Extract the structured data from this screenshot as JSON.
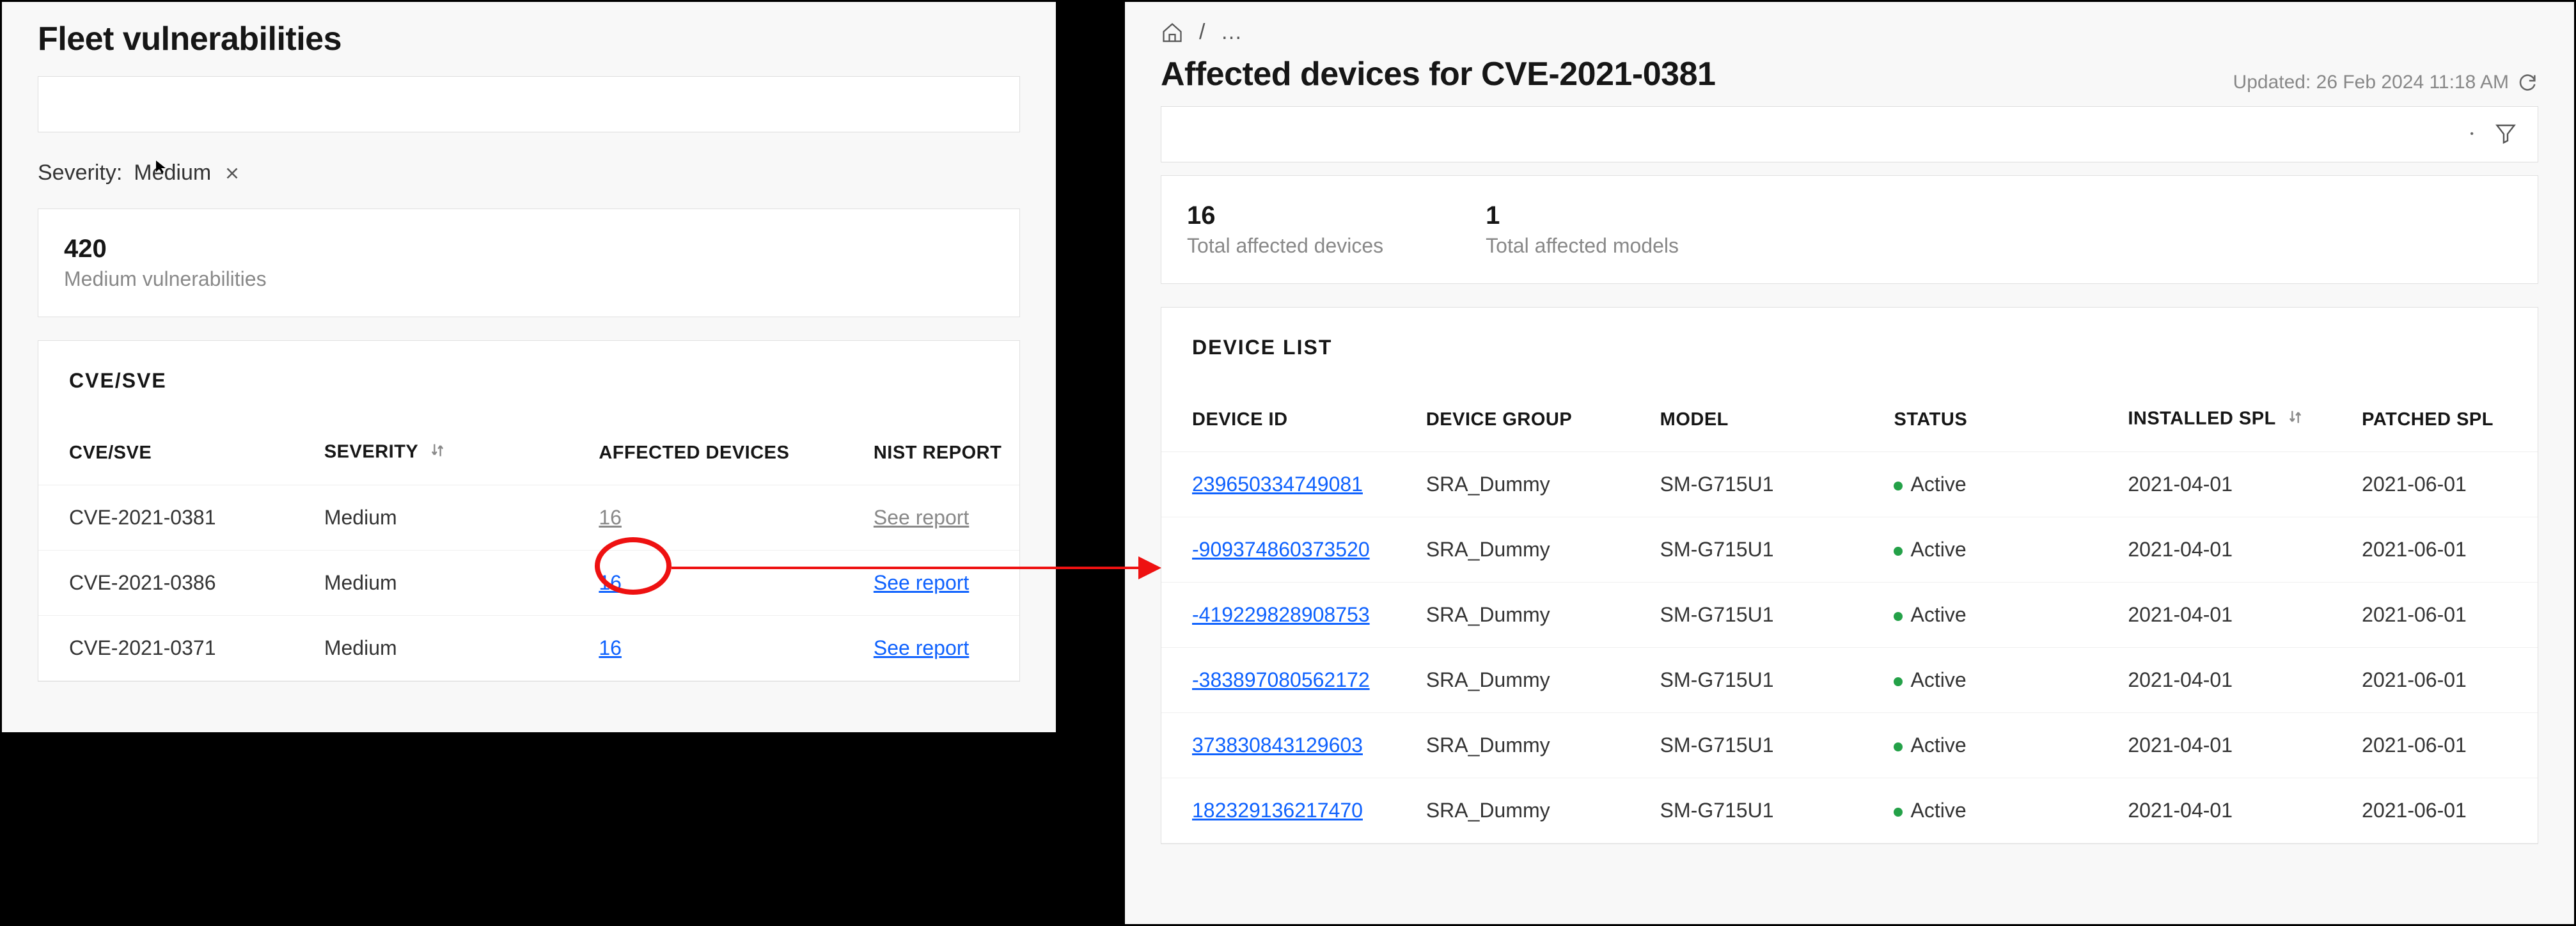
{
  "left": {
    "title": "Fleet vulnerabilities",
    "filter": {
      "label": "Severity:",
      "value": "Medium"
    },
    "stat": {
      "value": "420",
      "label": "Medium vulnerabilities"
    },
    "table": {
      "title": "CVE/SVE",
      "headers": {
        "cve": "CVE/SVE",
        "severity": "SEVERITY",
        "affected": "AFFECTED DEVICES",
        "nist": "NIST REPORT"
      },
      "rows": [
        {
          "cve": "CVE-2021-0381",
          "severity": "Medium",
          "affected": "16",
          "nist": "See report"
        },
        {
          "cve": "CVE-2021-0386",
          "severity": "Medium",
          "affected": "16",
          "nist": "See report"
        },
        {
          "cve": "CVE-2021-0371",
          "severity": "Medium",
          "affected": "16",
          "nist": "See report"
        }
      ]
    }
  },
  "right": {
    "title": "Affected devices for CVE-2021-0381",
    "updated": "Updated: 26 Feb 2024 11:18 AM",
    "stats": [
      {
        "value": "16",
        "label": "Total affected devices"
      },
      {
        "value": "1",
        "label": "Total affected models"
      }
    ],
    "table": {
      "title": "DEVICE LIST",
      "headers": {
        "id": "DEVICE ID",
        "group": "DEVICE GROUP",
        "model": "MODEL",
        "status": "STATUS",
        "installed_spl": "INSTALLED SPL",
        "patched_spl": "PATCHED SPL"
      },
      "rows": [
        {
          "id": "239650334749081",
          "group": "SRA_Dummy",
          "model": "SM-G715U1",
          "status": "Active",
          "installed_spl": "2021-04-01",
          "patched_spl": "2021-06-01"
        },
        {
          "id": "-909374860373520",
          "group": "SRA_Dummy",
          "model": "SM-G715U1",
          "status": "Active",
          "installed_spl": "2021-04-01",
          "patched_spl": "2021-06-01"
        },
        {
          "id": "-419229828908753",
          "group": "SRA_Dummy",
          "model": "SM-G715U1",
          "status": "Active",
          "installed_spl": "2021-04-01",
          "patched_spl": "2021-06-01"
        },
        {
          "id": "-383897080562172",
          "group": "SRA_Dummy",
          "model": "SM-G715U1",
          "status": "Active",
          "installed_spl": "2021-04-01",
          "patched_spl": "2021-06-01"
        },
        {
          "id": "373830843129603",
          "group": "SRA_Dummy",
          "model": "SM-G715U1",
          "status": "Active",
          "installed_spl": "2021-04-01",
          "patched_spl": "2021-06-01"
        },
        {
          "id": "182329136217470",
          "group": "SRA_Dummy",
          "model": "SM-G715U1",
          "status": "Active",
          "installed_spl": "2021-04-01",
          "patched_spl": "2021-06-01"
        }
      ]
    }
  }
}
